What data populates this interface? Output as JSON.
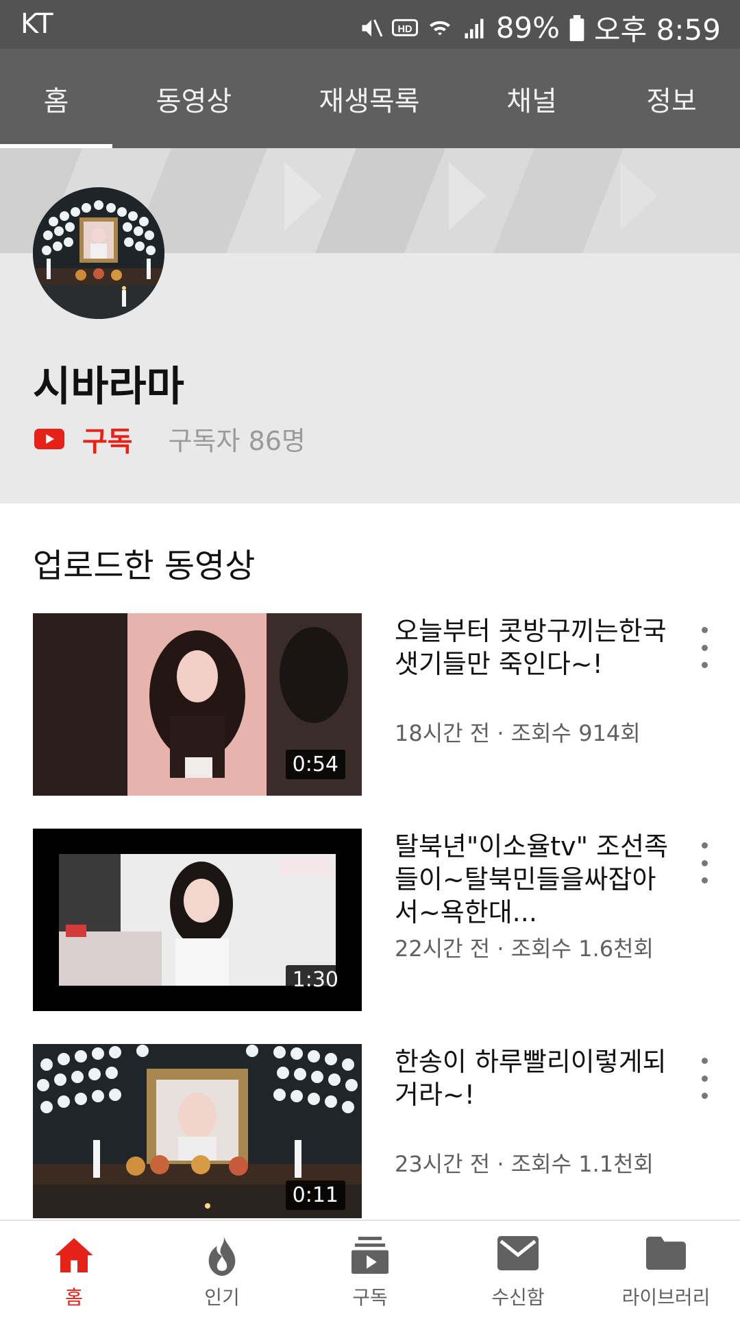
{
  "status_bar": {
    "carrier": "KT",
    "battery": "89%",
    "time": "오후 8:59"
  },
  "tabs": [
    {
      "label": "홈",
      "active": true
    },
    {
      "label": "동영상"
    },
    {
      "label": "재생목록"
    },
    {
      "label": "채널"
    },
    {
      "label": "정보"
    }
  ],
  "channel": {
    "name": "시바라마",
    "subscribe_label": "구독",
    "subscriber_count": "구독자 86명"
  },
  "section": {
    "title": "업로드한 동영상"
  },
  "videos": [
    {
      "title": "오늘부터 콧방구끼는한국샛기들만 죽인다~!",
      "meta": "18시간 전 · 조회수 914회",
      "duration": "0:54"
    },
    {
      "title": "탈북년\"이소율tv\" 조선족들이~탈북민들을싸잡아서~욕한대...",
      "meta": "22시간 전 · 조회수 1.6천회",
      "duration": "1:30"
    },
    {
      "title": "한송이 하루빨리이렇게되거라~!",
      "meta": "23시간 전 · 조회수 1.1천회",
      "duration": "0:11"
    }
  ],
  "bottom_nav": [
    {
      "label": "홈",
      "icon": "home-icon",
      "active": true
    },
    {
      "label": "인기",
      "icon": "flame-icon"
    },
    {
      "label": "구독",
      "icon": "subscriptions-icon"
    },
    {
      "label": "수신함",
      "icon": "mail-icon"
    },
    {
      "label": "라이브러리",
      "icon": "folder-icon"
    }
  ],
  "colors": {
    "accent": "#e62117",
    "status_bar": "#535353",
    "tab_bar": "#5f5f5f",
    "header_bg": "#e9e9e9"
  }
}
